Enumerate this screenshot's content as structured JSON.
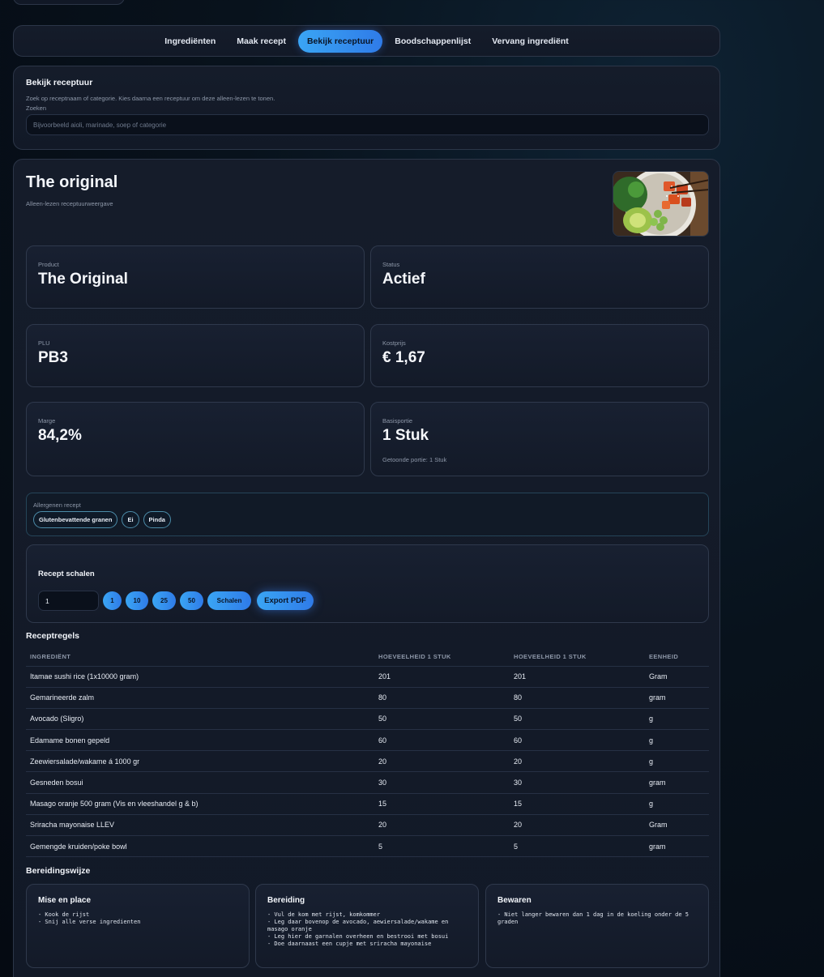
{
  "tabs": [
    {
      "label": "Ingrediënten",
      "active": false
    },
    {
      "label": "Maak recept",
      "active": false
    },
    {
      "label": "Bekijk receptuur",
      "active": true
    },
    {
      "label": "Boodschappenlijst",
      "active": false
    },
    {
      "label": "Vervang ingrediënt",
      "active": false
    }
  ],
  "search": {
    "title": "Bekijk receptuur",
    "description": "Zoek op receptnaam of categorie. Kies daarna een receptuur om deze alleen-lezen te tonen.",
    "label": "Zoeken",
    "placeholder": "Bijvoorbeeld aioli, marinade, soep of categorie",
    "value": ""
  },
  "recipe": {
    "title": "The original",
    "subtitle": "Alleen-lezen receptuurweergave",
    "image_icon": "poke-bowl-photo",
    "cards": {
      "product": {
        "label": "Product",
        "value": "The Original"
      },
      "status": {
        "label": "Status",
        "value": "Actief"
      },
      "plu": {
        "label": "PLU",
        "value": "PB3"
      },
      "cost": {
        "label": "Kostprijs",
        "value": "€ 1,67"
      },
      "margin": {
        "label": "Marge",
        "value": "84,2%"
      },
      "portion": {
        "label": "Basisportie",
        "value": "1 Stuk",
        "note": "Getoonde portie: 1 Stuk"
      }
    },
    "allergens": {
      "label": "Allergenen recept",
      "items": [
        "Glutenbevattende granen",
        "Ei",
        "Pinda"
      ]
    },
    "scale": {
      "title": "Recept schalen",
      "input_value": "1",
      "presets": [
        "1",
        "10",
        "25",
        "50"
      ],
      "scale_label": "Schalen",
      "export_label": "Export PDF"
    },
    "rules": {
      "title": "Receptregels",
      "headers": [
        "INGREDIËNT",
        "HOEVEELHEID 1 STUK",
        "HOEVEELHEID 1 STUK",
        "EENHEID"
      ],
      "rows": [
        [
          "Itamae sushi rice (1x10000 gram)",
          "201",
          "201",
          "Gram"
        ],
        [
          "Gemarineerde zalm",
          "80",
          "80",
          "gram"
        ],
        [
          "Avocado (Sligro)",
          "50",
          "50",
          "g"
        ],
        [
          "Edamame bonen gepeld",
          "60",
          "60",
          "g"
        ],
        [
          "Zeewiersalade/wakame á 1000 gr",
          "20",
          "20",
          "g"
        ],
        [
          "Gesneden bosui",
          "30",
          "30",
          "gram"
        ],
        [
          "Masago oranje 500 gram (Vis en vleeshandel g & b)",
          "15",
          "15",
          "g"
        ],
        [
          "Sriracha mayonaise LLEV",
          "20",
          "20",
          "Gram"
        ],
        [
          "Gemengde kruiden/poke bowl",
          "5",
          "5",
          "gram"
        ]
      ]
    },
    "preparation": {
      "title": "Bereidingswijze",
      "sections": [
        {
          "title": "Mise en place",
          "body": "- Kook de rijst\n- Snij alle verse ingredienten"
        },
        {
          "title": "Bereiding",
          "body": "- Vul de kom met rijst, komkommer\n- Leg daar bovenop de avocado, aewiersalade/wakame en masago oranje\n- Leg hier de garnalen overheen en bestrooi met bosui\n- Doe daarnaast een cupje met sriracha mayonaise"
        },
        {
          "title": "Bewaren",
          "body": "- Niet langer bewaren dan 1 dag in de koeling onder de 5 graden"
        }
      ]
    }
  }
}
